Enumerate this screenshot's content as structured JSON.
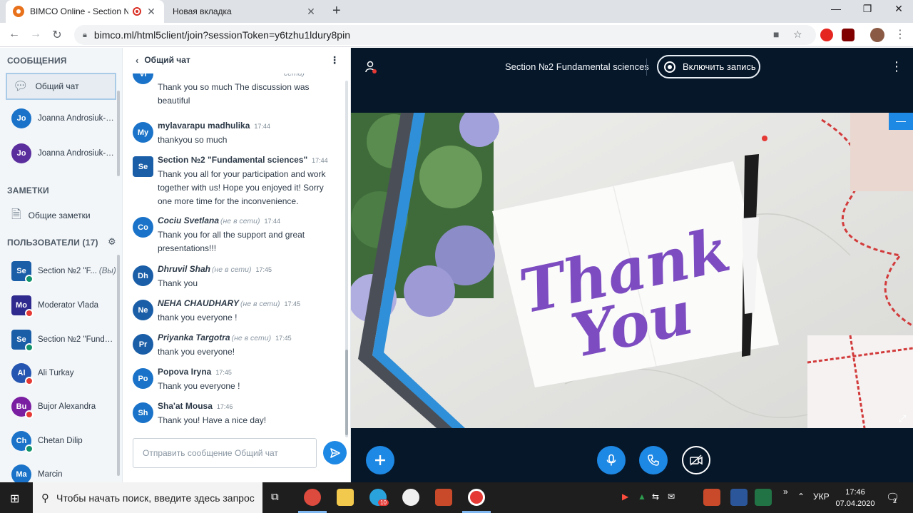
{
  "browser": {
    "tabs": [
      {
        "title": "BIMCO Online - Section №2 Fundamental sciences",
        "active": true
      },
      {
        "title": "Новая вкладка",
        "active": false
      }
    ],
    "url": "bimco.ml/html5client/join?sessionToken=y6tzhu1ldury8pin"
  },
  "sidebar": {
    "messages_header": "СООБЩЕНИЯ",
    "chats": [
      {
        "label": "Общий чат",
        "selected": true
      },
      {
        "initials": "Jo",
        "label": "Joanna Androsiuk-P...",
        "color": "#1a73c8"
      },
      {
        "initials": "Jo",
        "label": "Joanna Androsiuk-P...",
        "color": "#5b2e9e"
      }
    ],
    "notes_header": "ЗАМЕТКИ",
    "notes_label": "Общие заметки",
    "users_header": "ПОЛЬЗОВАТЕЛИ (17)",
    "users": [
      {
        "initials": "Se",
        "name": "Section №2 \"F...",
        "you": "(Вы)",
        "color": "#1a5ea8",
        "shape": "square",
        "badge": "#12936b"
      },
      {
        "initials": "Mo",
        "name": "Moderator Vlada",
        "you": "",
        "color": "#2e2a8e",
        "shape": "square",
        "badge": "#e53935"
      },
      {
        "initials": "Se",
        "name": "Section №2 \"Funda...",
        "you": "",
        "color": "#1a5ea8",
        "shape": "square",
        "badge": "#12936b"
      },
      {
        "initials": "Al",
        "name": "Ali Turkay",
        "you": "",
        "color": "#2455b0",
        "shape": "circle",
        "badge": "#e53935"
      },
      {
        "initials": "Bu",
        "name": "Bujor Alexandra",
        "you": "",
        "color": "#7b1fa2",
        "shape": "circle",
        "badge": "#e53935"
      },
      {
        "initials": "Ch",
        "name": "Chetan Dilip",
        "you": "",
        "color": "#1a73c8",
        "shape": "circle",
        "badge": "#12936b"
      },
      {
        "initials": "Ma",
        "name": "Marcin",
        "you": "",
        "color": "#1a73c8",
        "shape": "circle",
        "badge": ""
      }
    ]
  },
  "chat": {
    "title": "Общий чат",
    "messages": [
      {
        "initials": "Vi",
        "color": "#1a73c8",
        "name": "",
        "offline": "сети)",
        "time": "",
        "text": "Thank you so much The discussion was beautiful"
      },
      {
        "initials": "My",
        "color": "#1a73c8",
        "name": "mylavarapu madhulika",
        "offline": "",
        "time": "17:44",
        "text": "thankyou so much"
      },
      {
        "initials": "Se",
        "color": "#1a5ea8",
        "shape": "square",
        "name": "Section №2 \"Fundamental sciences\"",
        "offline": "",
        "time": "17:44",
        "text": "Thank you all for your participation and work together with us! Hope you enjoyed it! Sorry one more time for the inconvenience."
      },
      {
        "initials": "Co",
        "color": "#1a73c8",
        "name": "Cociu Svetlana",
        "offline": "(не в сети)",
        "time": "17:44",
        "text": "Thank you for all the support and great presentations!!!"
      },
      {
        "initials": "Dh",
        "color": "#1a5ea8",
        "name": "Dhruvil Shah",
        "offline": "(не в сети)",
        "time": "17:45",
        "text": "Thank you"
      },
      {
        "initials": "Ne",
        "color": "#1a5ea8",
        "name": "NEHA CHAUDHARY",
        "offline": "(не в сети)",
        "time": "17:45",
        "text": "thank you everyone !"
      },
      {
        "initials": "Pr",
        "color": "#1a5ea8",
        "name": "Priyanka Targotra",
        "offline": "(не в сети)",
        "time": "17:45",
        "text": "thank you everyone!"
      },
      {
        "initials": "Po",
        "color": "#1a73c8",
        "name": "Popova Iryna",
        "offline": "",
        "time": "17:45",
        "text": "Thank you everyone !"
      },
      {
        "initials": "Sh",
        "color": "#1a73c8",
        "name": "Sha'at Mousa",
        "offline": "",
        "time": "17:46",
        "text": "Thank you! Have a nice day!"
      }
    ],
    "input_placeholder": "Отправить сообщение Общий чат"
  },
  "presentation": {
    "title": "Section №2 Fundamental sciences",
    "record_label": "Включить запись",
    "slide_text_line1": "Thank",
    "slide_text_line2": "You"
  },
  "taskbar": {
    "search_placeholder": "Чтобы начать поиск, введите здесь запрос",
    "language": "УКР",
    "time": "17:46",
    "date": "07.04.2020",
    "notifications": "2",
    "telegram_badge": "10"
  }
}
